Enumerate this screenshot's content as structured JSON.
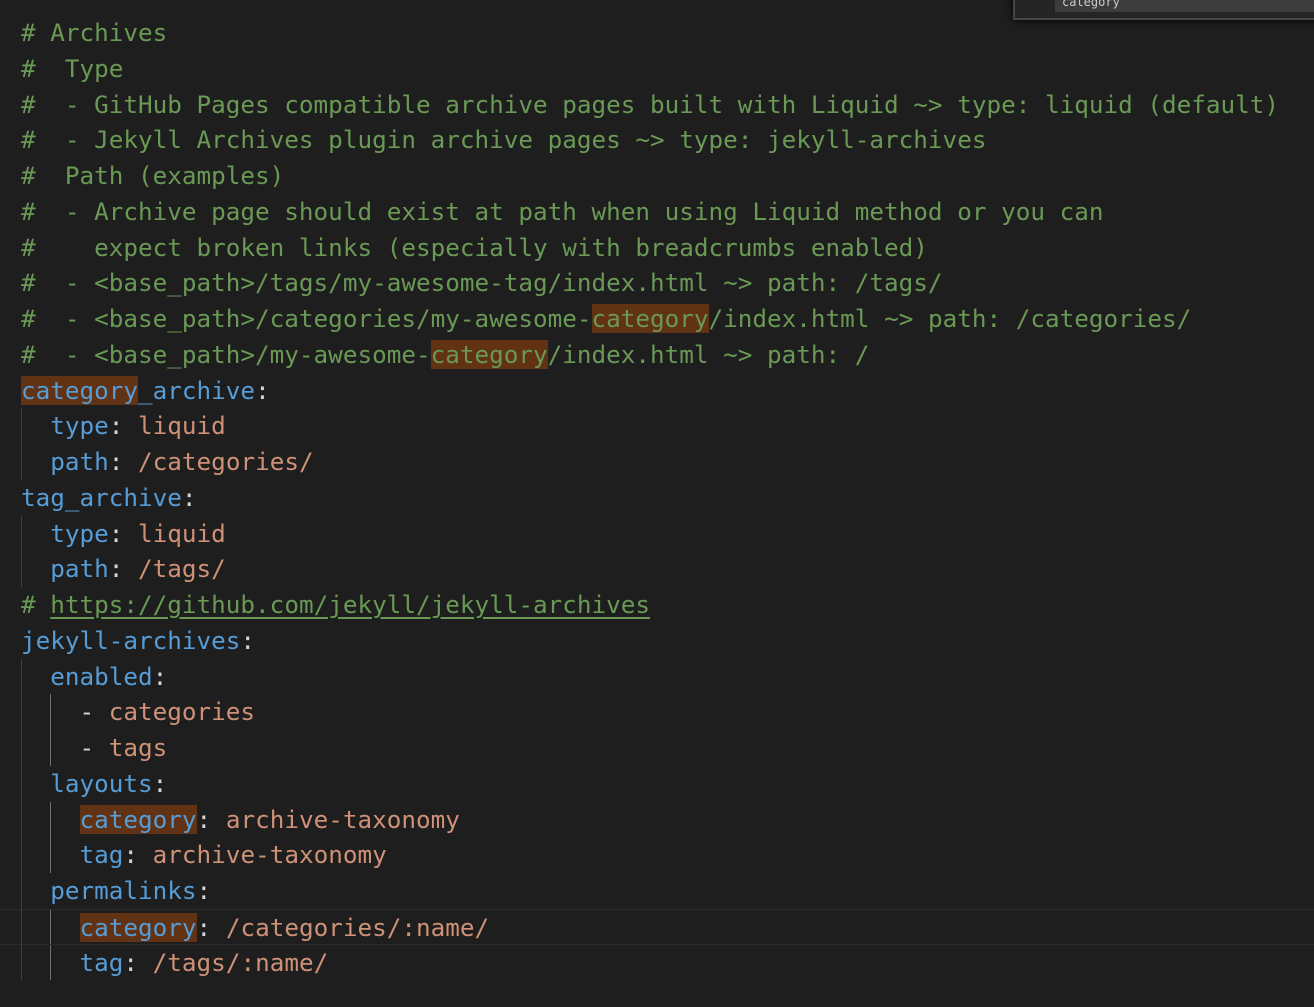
{
  "find_widget": {
    "query": "category"
  },
  "lines": [
    {
      "indent": 0,
      "tokens": [
        {
          "t": "# Archives",
          "c": "comment"
        }
      ]
    },
    {
      "indent": 0,
      "tokens": [
        {
          "t": "#  Type",
          "c": "comment"
        }
      ]
    },
    {
      "indent": 0,
      "tokens": [
        {
          "t": "#  - GitHub Pages compatible archive pages built with Liquid ~> type: liquid (default)",
          "c": "comment"
        }
      ]
    },
    {
      "indent": 0,
      "tokens": [
        {
          "t": "#  - Jekyll Archives plugin archive pages ~> type: jekyll-archives",
          "c": "comment"
        }
      ]
    },
    {
      "indent": 0,
      "tokens": [
        {
          "t": "#  Path (examples)",
          "c": "comment"
        }
      ]
    },
    {
      "indent": 0,
      "tokens": [
        {
          "t": "#  - Archive page should exist at path when using Liquid method or you can",
          "c": "comment"
        }
      ]
    },
    {
      "indent": 0,
      "tokens": [
        {
          "t": "#    expect broken links (especially with breadcrumbs enabled)",
          "c": "comment"
        }
      ]
    },
    {
      "indent": 0,
      "tokens": [
        {
          "t": "#  - <base_path>/tags/my-awesome-tag/index.html ~> path: /tags/",
          "c": "comment"
        }
      ]
    },
    {
      "indent": 0,
      "tokens": [
        {
          "t": "#  - <base_path>/categories/my-awesome-",
          "c": "comment"
        },
        {
          "t": "category",
          "c": "comment",
          "hl": true
        },
        {
          "t": "/index.html ~> path: /categories/",
          "c": "comment"
        }
      ]
    },
    {
      "indent": 0,
      "tokens": [
        {
          "t": "#  - <base_path>/my-awesome-",
          "c": "comment"
        },
        {
          "t": "category",
          "c": "comment",
          "hl": true
        },
        {
          "t": "/index.html ~> path: /",
          "c": "comment"
        }
      ]
    },
    {
      "indent": 0,
      "tokens": [
        {
          "t": "category",
          "c": "key",
          "hl": true
        },
        {
          "t": "_archive",
          "c": "key"
        },
        {
          "t": ":",
          "c": "punct"
        }
      ]
    },
    {
      "indent": 1,
      "tokens": [
        {
          "t": "  ",
          "c": "punct"
        },
        {
          "t": "type",
          "c": "key"
        },
        {
          "t": ": ",
          "c": "punct"
        },
        {
          "t": "liquid",
          "c": "str"
        }
      ]
    },
    {
      "indent": 1,
      "tokens": [
        {
          "t": "  ",
          "c": "punct"
        },
        {
          "t": "path",
          "c": "key"
        },
        {
          "t": ": ",
          "c": "punct"
        },
        {
          "t": "/categories/",
          "c": "str"
        }
      ]
    },
    {
      "indent": 0,
      "tokens": [
        {
          "t": "tag_archive",
          "c": "key"
        },
        {
          "t": ":",
          "c": "punct"
        }
      ]
    },
    {
      "indent": 1,
      "tokens": [
        {
          "t": "  ",
          "c": "punct"
        },
        {
          "t": "type",
          "c": "key"
        },
        {
          "t": ": ",
          "c": "punct"
        },
        {
          "t": "liquid",
          "c": "str"
        }
      ]
    },
    {
      "indent": 1,
      "tokens": [
        {
          "t": "  ",
          "c": "punct"
        },
        {
          "t": "path",
          "c": "key"
        },
        {
          "t": ": ",
          "c": "punct"
        },
        {
          "t": "/tags/",
          "c": "str"
        }
      ]
    },
    {
      "indent": 0,
      "tokens": [
        {
          "t": "# ",
          "c": "comment"
        },
        {
          "t": "https://github.com/jekyll/jekyll-archives",
          "c": "link"
        }
      ]
    },
    {
      "indent": 0,
      "tokens": [
        {
          "t": "jekyll-archives",
          "c": "key"
        },
        {
          "t": ":",
          "c": "punct"
        }
      ]
    },
    {
      "indent": 1,
      "tokens": [
        {
          "t": "  ",
          "c": "punct"
        },
        {
          "t": "enabled",
          "c": "key"
        },
        {
          "t": ":",
          "c": "punct"
        }
      ]
    },
    {
      "indent": 2,
      "tokens": [
        {
          "t": "    - ",
          "c": "punct"
        },
        {
          "t": "categories",
          "c": "str"
        }
      ]
    },
    {
      "indent": 2,
      "tokens": [
        {
          "t": "    - ",
          "c": "punct"
        },
        {
          "t": "tags",
          "c": "str"
        }
      ]
    },
    {
      "indent": 1,
      "tokens": [
        {
          "t": "  ",
          "c": "punct"
        },
        {
          "t": "layouts",
          "c": "key"
        },
        {
          "t": ":",
          "c": "punct"
        }
      ]
    },
    {
      "indent": 2,
      "tokens": [
        {
          "t": "    ",
          "c": "punct"
        },
        {
          "t": "category",
          "c": "key",
          "hl": true
        },
        {
          "t": ": ",
          "c": "punct"
        },
        {
          "t": "archive-taxonomy",
          "c": "str"
        }
      ]
    },
    {
      "indent": 2,
      "tokens": [
        {
          "t": "    ",
          "c": "punct"
        },
        {
          "t": "tag",
          "c": "key"
        },
        {
          "t": ": ",
          "c": "punct"
        },
        {
          "t": "archive-taxonomy",
          "c": "str"
        }
      ]
    },
    {
      "indent": 1,
      "tokens": [
        {
          "t": "  ",
          "c": "punct"
        },
        {
          "t": "permalinks",
          "c": "key"
        },
        {
          "t": ":",
          "c": "punct"
        }
      ]
    },
    {
      "indent": 2,
      "current": true,
      "tokens": [
        {
          "t": "    ",
          "c": "punct"
        },
        {
          "t": "category",
          "c": "key",
          "hl": true
        },
        {
          "t": ": ",
          "c": "punct"
        },
        {
          "t": "/categories/:name/",
          "c": "str"
        }
      ]
    },
    {
      "indent": 2,
      "tokens": [
        {
          "t": "    ",
          "c": "punct"
        },
        {
          "t": "tag",
          "c": "key"
        },
        {
          "t": ": ",
          "c": "punct"
        },
        {
          "t": "/tags/:name/",
          "c": "str"
        }
      ]
    }
  ]
}
